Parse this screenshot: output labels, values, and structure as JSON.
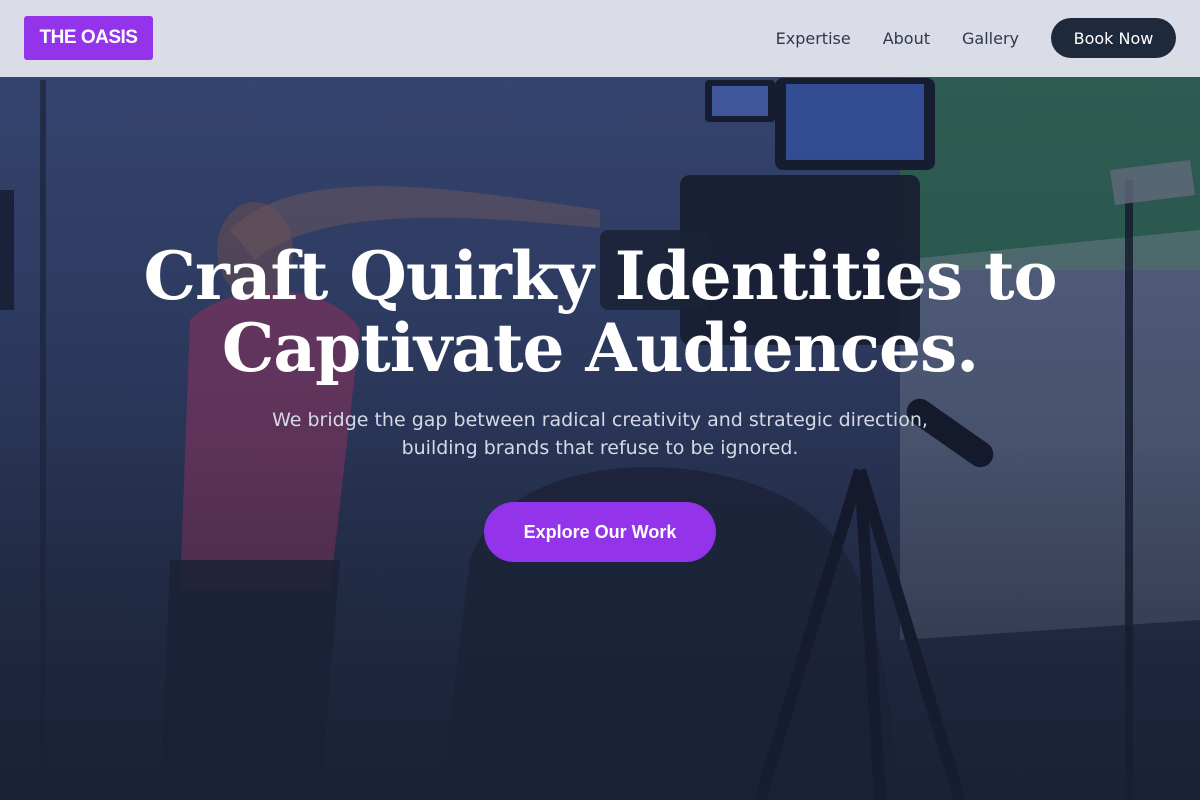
{
  "brand": {
    "logo_text": "THE OASIS",
    "accent": "#9333ea",
    "dark": "#1e293b"
  },
  "nav": {
    "links": [
      {
        "label": "Expertise"
      },
      {
        "label": "About"
      },
      {
        "label": "Gallery"
      }
    ],
    "cta_label": "Book Now"
  },
  "hero": {
    "headline": "Craft Quirky Identities to Captivate Audiences.",
    "subtitle": "We bridge the gap between radical creativity and strategic direction, building brands that refuse to be ignored.",
    "cta_label": "Explore Our Work",
    "background_image": "film-studio-photo"
  }
}
